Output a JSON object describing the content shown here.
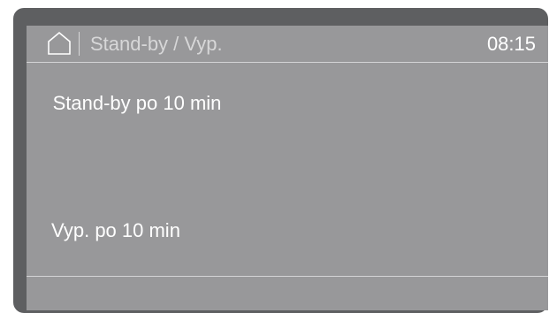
{
  "header": {
    "home_icon": "home-icon",
    "title": "Stand-by / Vyp.",
    "time": "08:15"
  },
  "options": [
    {
      "label": "Stand-by po 10 min"
    },
    {
      "label": "Vyp. po 10 min"
    }
  ],
  "colors": {
    "bezel": "#5e5f61",
    "screen": "#98989a",
    "text": "#ffffff",
    "title_text": "#d7d7d8"
  }
}
